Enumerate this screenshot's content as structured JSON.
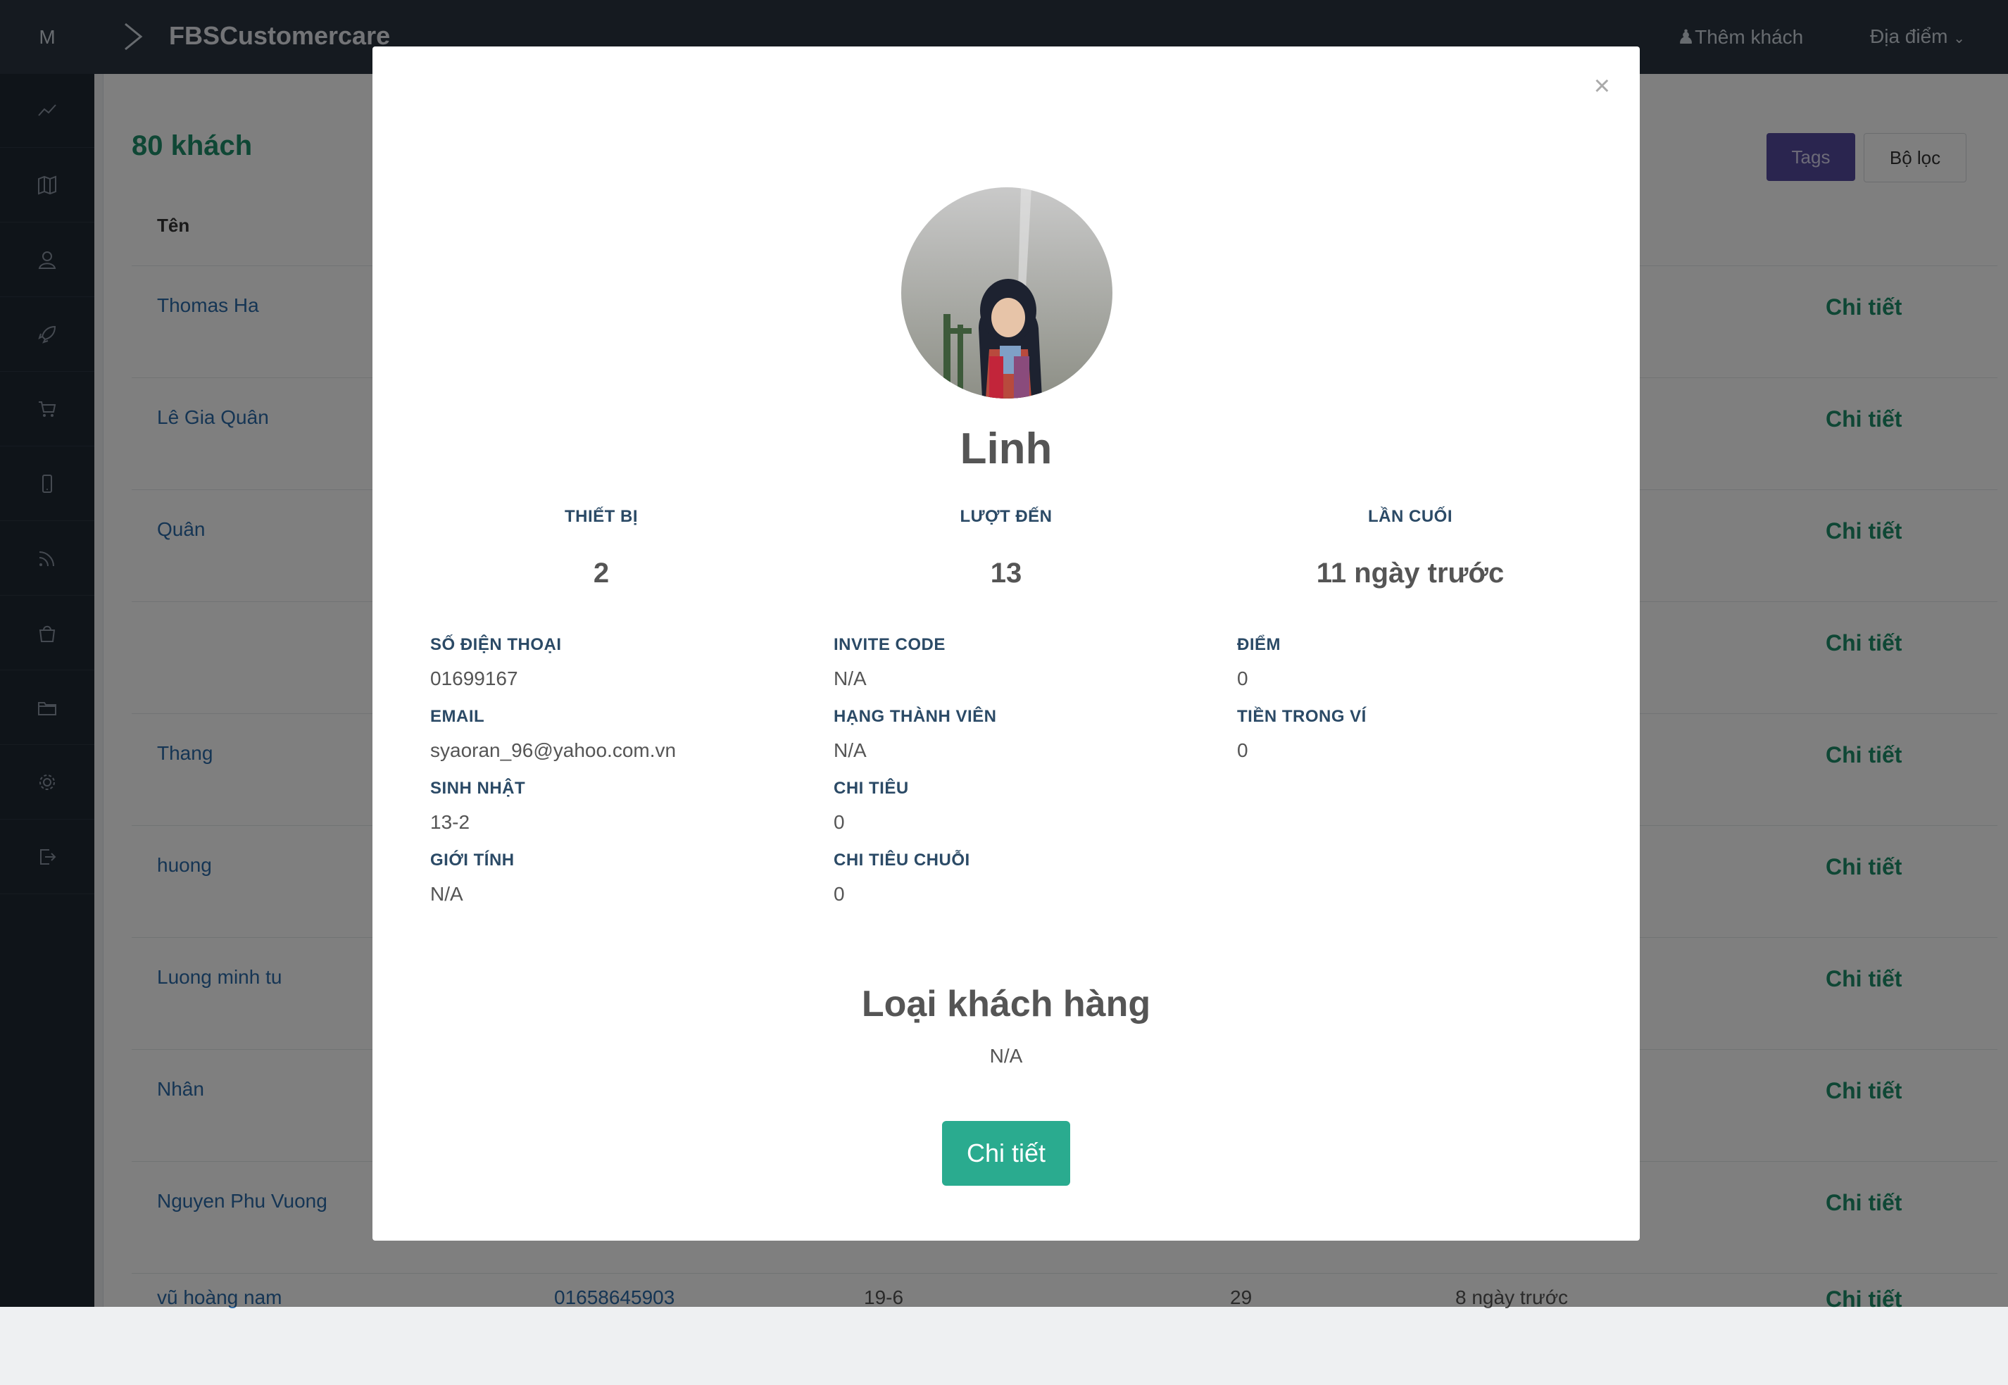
{
  "topbar": {
    "logo_letter": "M",
    "brand": "FBSCustomercare",
    "add_customer": "Thêm khách",
    "location": "Địa điểm"
  },
  "sidebar": {
    "icons": [
      "chart-icon",
      "map-icon",
      "user-icon",
      "rocket-icon",
      "cart-icon",
      "phone-icon",
      "rss-icon",
      "bag-icon",
      "folder-icon",
      "gear-icon",
      "logout-icon"
    ]
  },
  "main": {
    "count": "80 khách",
    "tags_label": "Tags",
    "filter_label": "Bộ lọc",
    "column_name": "Tên",
    "detail_label": "Chi tiết",
    "rows": [
      {
        "name": "Thomas Ha"
      },
      {
        "name": "Lê Gia Quân"
      },
      {
        "name": "Quân"
      },
      {
        "name": ""
      },
      {
        "name": "Thang"
      },
      {
        "name": "huong"
      },
      {
        "name": "Luong minh tu"
      },
      {
        "name": "Nhân"
      },
      {
        "name": "Nguyen Phu Vuong"
      }
    ],
    "partial_row": {
      "name": "vũ hoàng nam",
      "phone": "01658645903",
      "birthday": "19-6",
      "visits": "29",
      "last": "8 ngày trước",
      "detail": "Chi tiết"
    }
  },
  "modal": {
    "close": "×",
    "name": "Linh",
    "stats": [
      {
        "label": "THIẾT BỊ",
        "value": "2"
      },
      {
        "label": "LƯỢT ĐẾN",
        "value": "13"
      },
      {
        "label": "LẦN CUỐI",
        "value": "11 ngày trước"
      }
    ],
    "fields": {
      "phone": {
        "label": "SỐ ĐIỆN THOẠI",
        "value": "01699167"
      },
      "email": {
        "label": "EMAIL",
        "value": "syaoran_96@yahoo.com.vn"
      },
      "birthday": {
        "label": "SINH NHẬT",
        "value": "13-2"
      },
      "gender": {
        "label": "GIỚI TÍNH",
        "value": "N/A"
      },
      "invite": {
        "label": "INVITE CODE",
        "value": "N/A"
      },
      "rank": {
        "label": "HẠNG THÀNH VIÊN",
        "value": "N/A"
      },
      "spending": {
        "label": "CHI TIÊU",
        "value": "0"
      },
      "chain_spending": {
        "label": "CHI TIÊU CHUỖI",
        "value": "0"
      },
      "points": {
        "label": "ĐIỂM",
        "value": "0"
      },
      "wallet": {
        "label": "TIỀN TRONG VÍ",
        "value": "0"
      }
    },
    "customer_type_title": "Loại khách hàng",
    "customer_type_value": "N/A",
    "detail_button": "Chi tiết"
  },
  "colors": {
    "accent": "#1f8f6a",
    "button_teal": "#2aab8f",
    "tags_purple": "#554a9e",
    "topbar": "#2a3441",
    "sidebar": "#1f2833"
  }
}
